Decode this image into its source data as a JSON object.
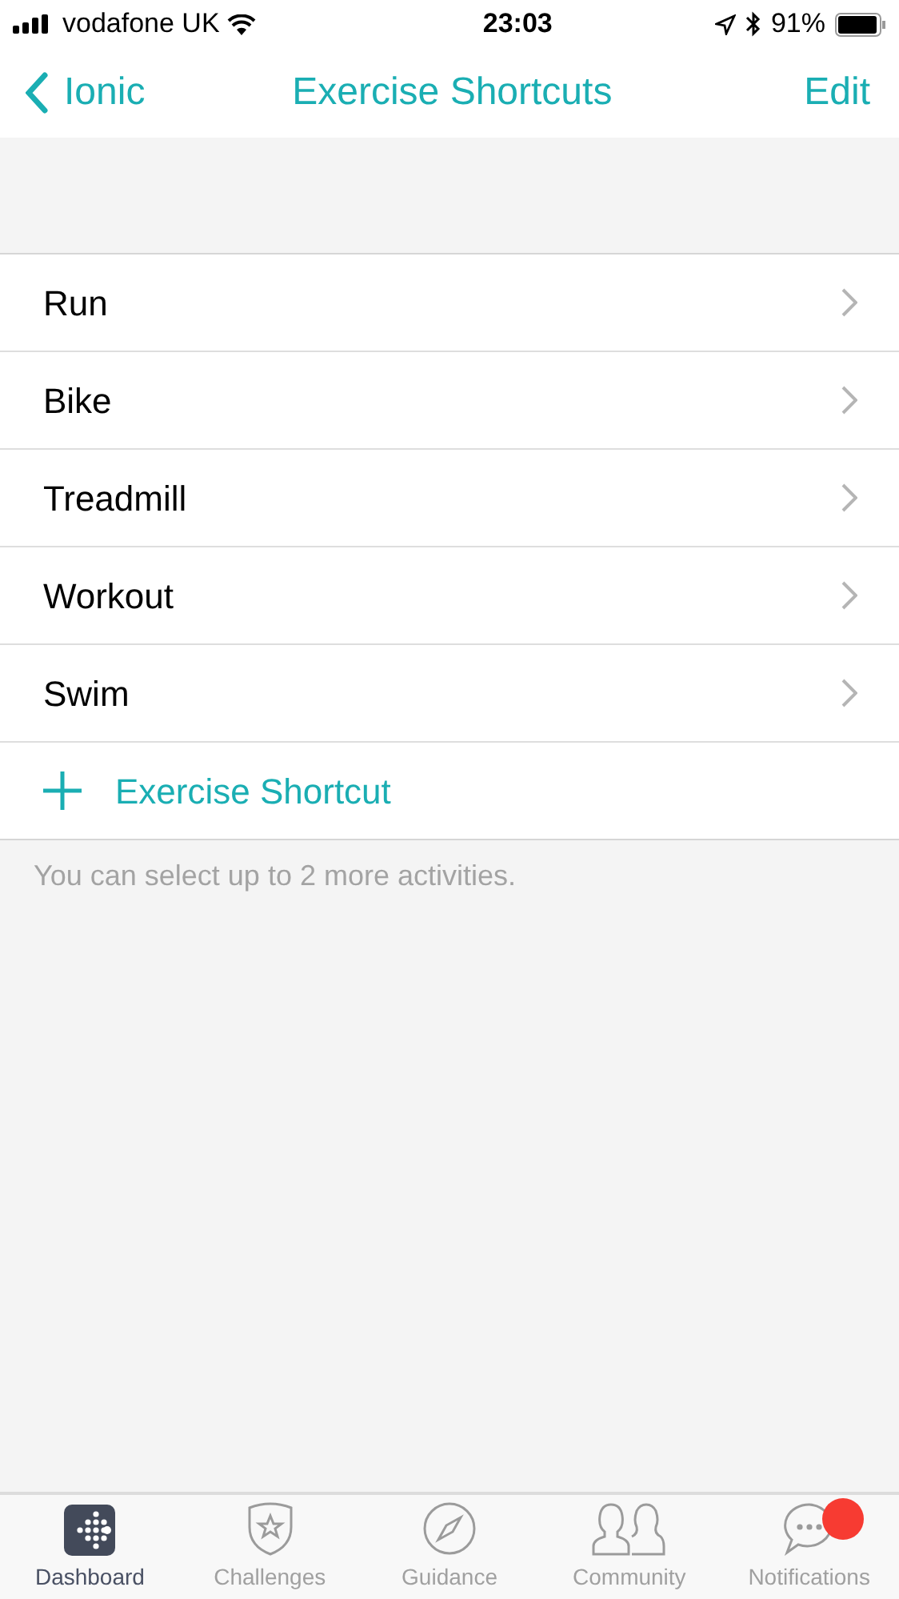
{
  "status_bar": {
    "carrier": "vodafone UK",
    "time": "23:03",
    "battery": "91%"
  },
  "nav": {
    "back": "Ionic",
    "title": "Exercise Shortcuts",
    "action": "Edit"
  },
  "shortcuts": [
    {
      "label": "Run"
    },
    {
      "label": "Bike"
    },
    {
      "label": "Treadmill"
    },
    {
      "label": "Workout"
    },
    {
      "label": "Swim"
    }
  ],
  "add_button": "Exercise Shortcut",
  "note": "You can select up to 2 more activities.",
  "tab_bar": [
    {
      "kind": "dashboard",
      "label": "Dashboard",
      "selected": true,
      "badge": false
    },
    {
      "kind": "challenges",
      "label": "Challenges",
      "selected": false,
      "badge": false
    },
    {
      "kind": "guidance",
      "label": "Guidance",
      "selected": false,
      "badge": false
    },
    {
      "kind": "community",
      "label": "Community",
      "selected": false,
      "badge": false
    },
    {
      "kind": "notifications",
      "label": "Notifications",
      "selected": false,
      "badge": true
    }
  ]
}
